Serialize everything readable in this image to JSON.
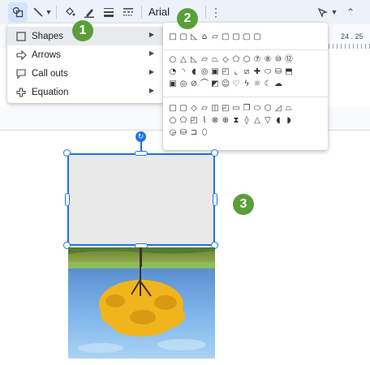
{
  "toolbar": {
    "font_name": "Arial"
  },
  "ruler": {
    "marks": "24 . 25"
  },
  "menu": {
    "items": [
      {
        "label": "Shapes",
        "icon": "rectangle-icon"
      },
      {
        "label": "Arrows",
        "icon": "arrow-icon"
      },
      {
        "label": "Call outs",
        "icon": "callout-icon"
      },
      {
        "label": "Equation",
        "icon": "plus-icon"
      }
    ]
  },
  "badges": {
    "one": "1",
    "two": "2",
    "three": "3"
  },
  "colors": {
    "accent": "#1a73e8",
    "badge": "#5a9e3a",
    "toolbar_bg": "#edf2fa"
  }
}
